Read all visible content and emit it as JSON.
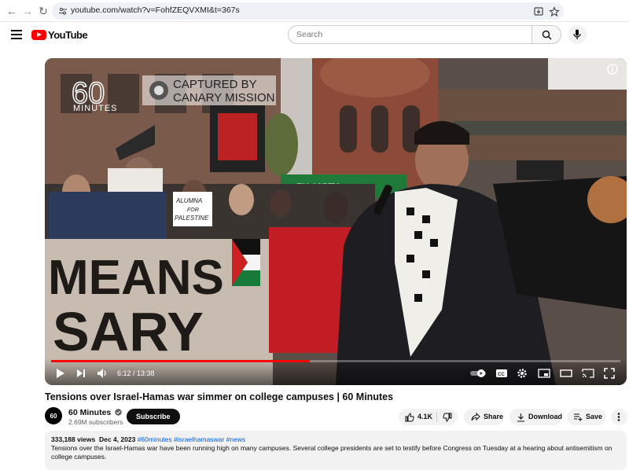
{
  "browser": {
    "url": "youtube.com/watch?v=FohfZEQVXMI&t=367s"
  },
  "header": {
    "logo_text": "YouTube",
    "search_placeholder": "Search"
  },
  "player": {
    "overlay_brand": "60 MINUTES",
    "overlay_brand_line1": "60",
    "overlay_brand_line2": "MINUTES",
    "overlay_captured_line1": "CAPTURED BY",
    "overlay_captured_line2": "CANARY MISSION",
    "banner_text_line1": "MEANS",
    "banner_text_line2": "SARY",
    "sign_text_line1": "ALUMNA",
    "sign_text_line2": "FOR",
    "sign_text_line3": "PALESTINE",
    "truck_text": "ZX-135/70",
    "current_time": "6:12",
    "duration": "13:38",
    "time_display": "6:12 / 13:38",
    "progress_fraction": 0.455
  },
  "video": {
    "title": "Tensions over Israel-Hamas war simmer on college campuses | 60 Minutes",
    "channel_name": "60 Minutes",
    "avatar_text": "60",
    "subscribers": "2.69M subscribers",
    "subscribe_label": "Subscribe",
    "likes": "4.1K",
    "share_label": "Share",
    "download_label": "Download",
    "save_label": "Save"
  },
  "description": {
    "views": "333,188 views",
    "date": "Dec 4, 2023",
    "hashtags": "#60minutes #israelhamaswar #news",
    "text": "Tensions over the Israel-Hamas war have been running high on many campuses. Several college presidents are set to testify before Congress on Tuesday at a hearing about antisemitism on college campuses."
  },
  "colors": {
    "brand_red": "#ff0000",
    "link_blue": "#065fd4"
  }
}
